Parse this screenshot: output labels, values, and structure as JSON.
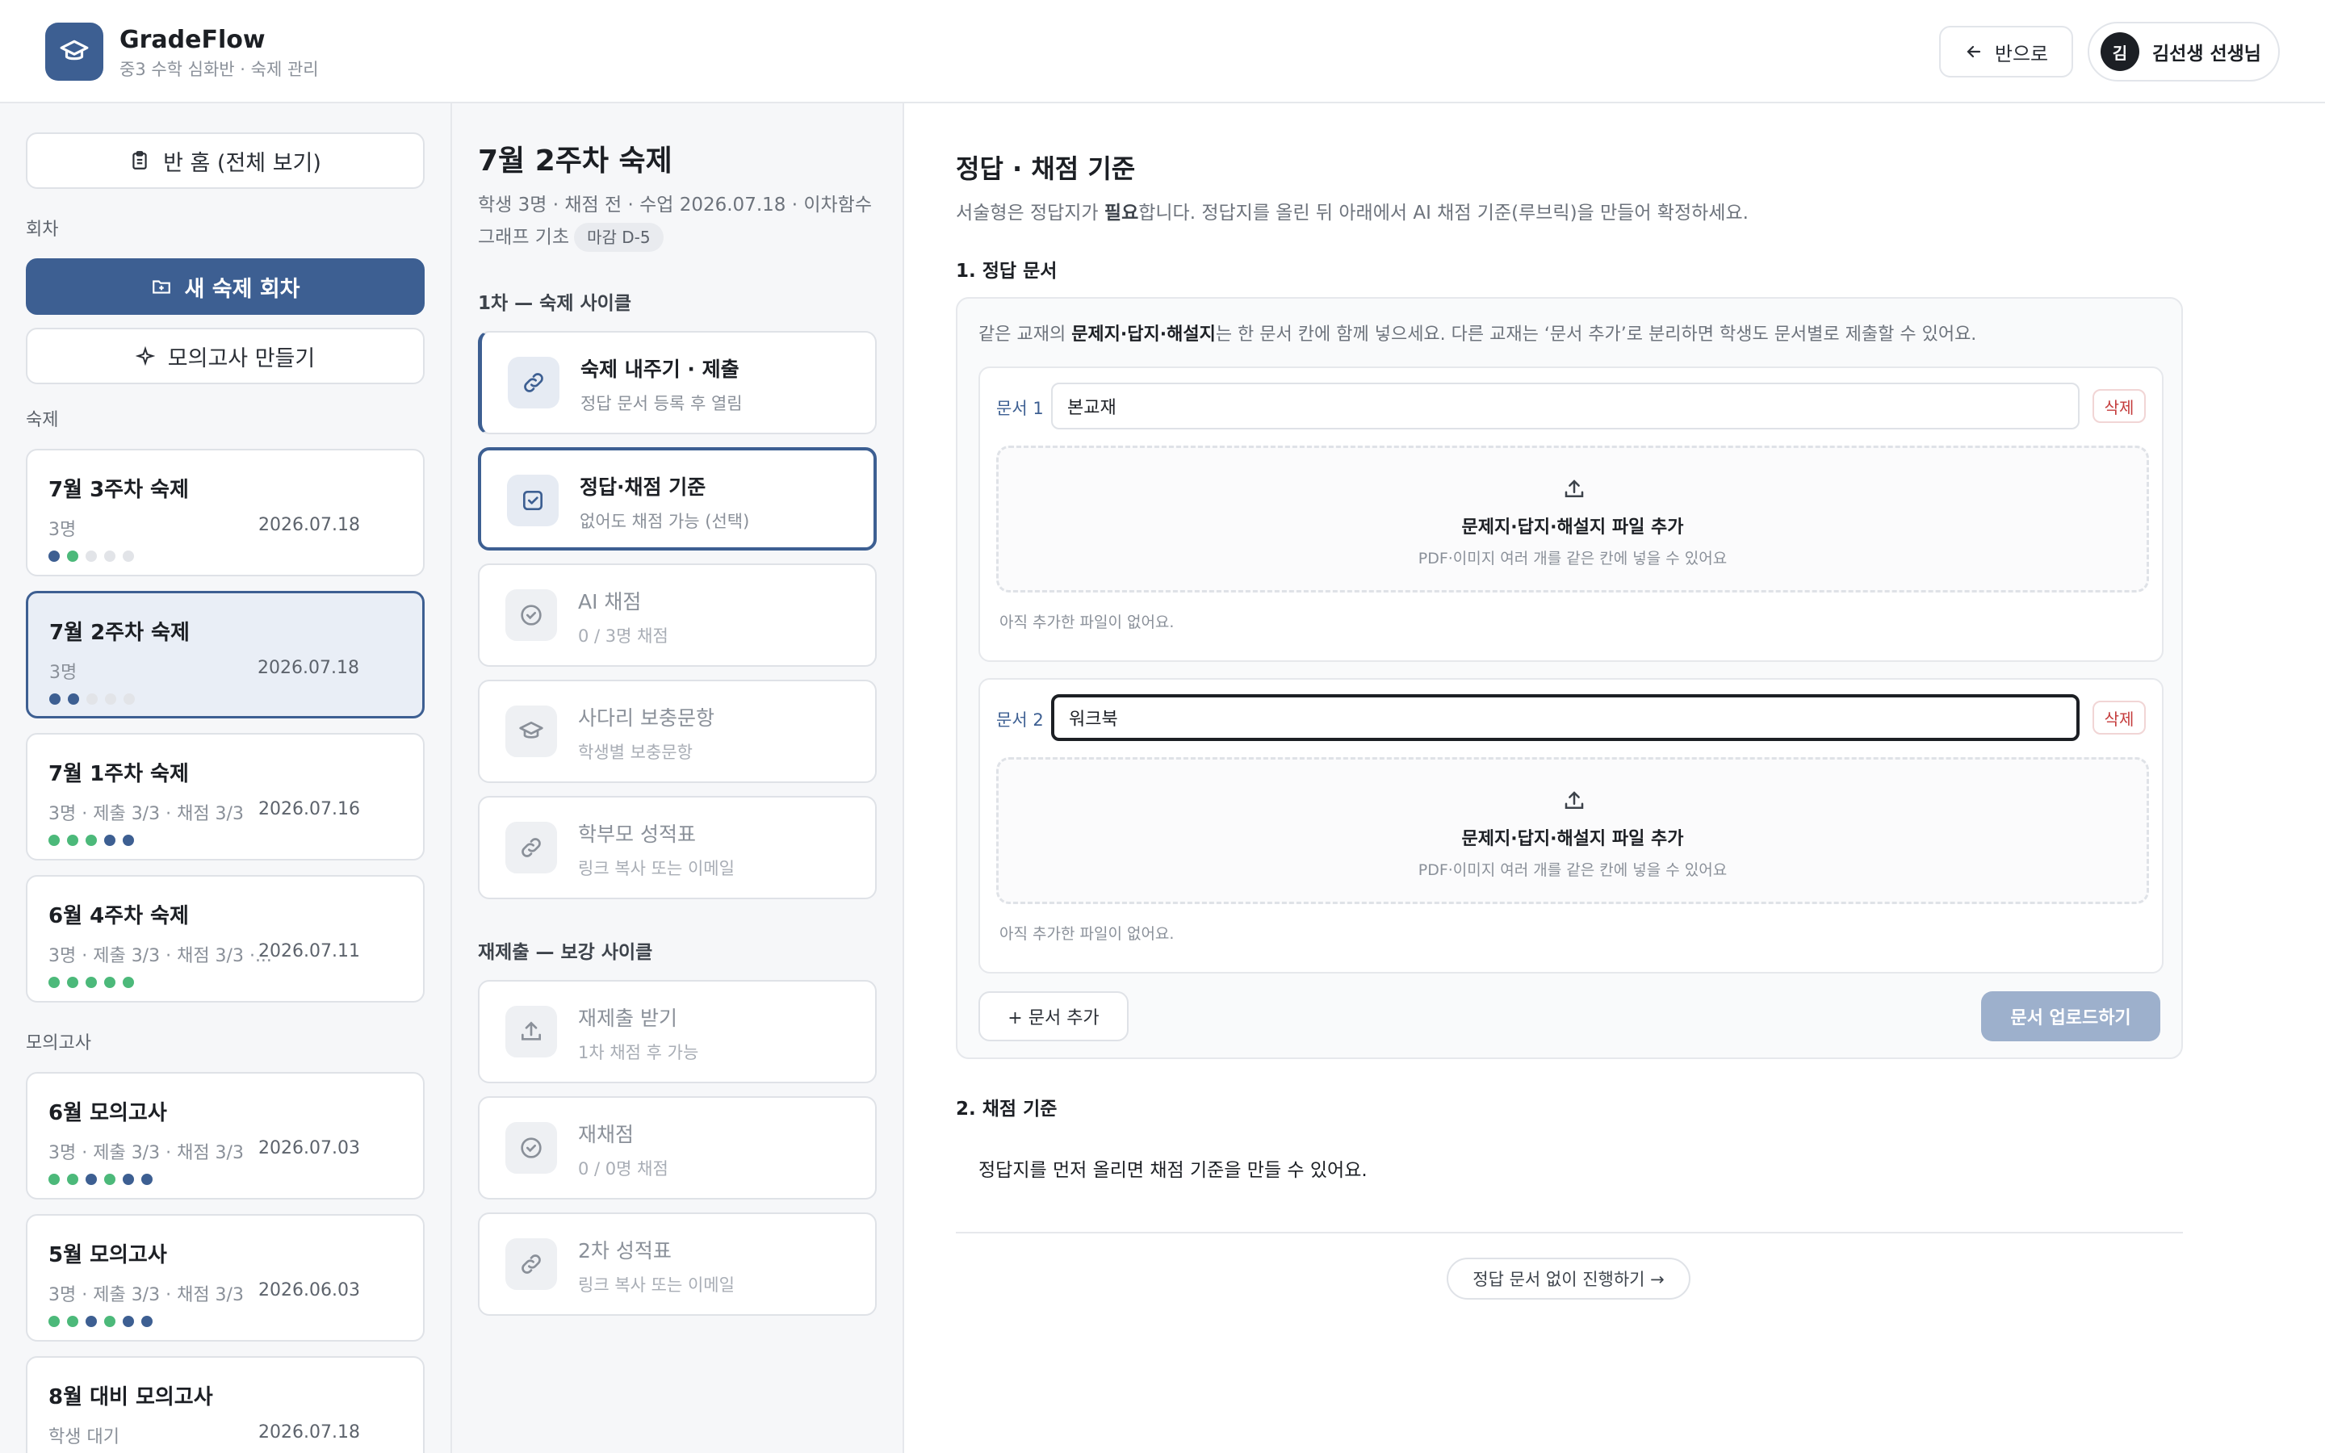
{
  "header": {
    "app_name": "GradeFlow",
    "app_sub": "중3 수학 심화반 · 숙제 관리",
    "back_label": "반으로",
    "user_initial": "김",
    "user_name": "김선생 선생님"
  },
  "sidebar": {
    "home_label": "반 홈 (전체 보기)",
    "rounds_label": "회차",
    "new_round_label": "새 숙제 회차",
    "mock_exam_create_label": "모의고사 만들기",
    "homework_label": "숙제",
    "homework": [
      {
        "title": "7월 3주차 숙제",
        "sub": "3명",
        "date": "2026.07.18",
        "dots": [
          "blue",
          "green",
          "gray",
          "gray",
          "gray"
        ]
      },
      {
        "title": "7월 2주차 숙제",
        "sub": "3명",
        "date": "2026.07.18",
        "dots": [
          "blue",
          "blue",
          "gray",
          "gray",
          "gray"
        ]
      },
      {
        "title": "7월 1주차 숙제",
        "sub": "3명 · 제출 3/3 · 채점 3/3",
        "date": "2026.07.16",
        "dots": [
          "green",
          "green",
          "green",
          "blue",
          "blue"
        ]
      },
      {
        "title": "6월 4주차 숙제",
        "sub": "3명 · 제출 3/3 · 채점 3/3 ·...",
        "date": "2026.07.11",
        "dots": [
          "green",
          "green",
          "green",
          "green",
          "green"
        ]
      }
    ],
    "mock_label": "모의고사",
    "mock_exams": [
      {
        "title": "6월 모의고사",
        "sub": "3명 · 제출 3/3 · 채점 3/3",
        "date": "2026.07.03",
        "dots": [
          "green",
          "green",
          "blue",
          "green",
          "blue",
          "blue"
        ]
      },
      {
        "title": "5월 모의고사",
        "sub": "3명 · 제출 3/3 · 채점 3/3",
        "date": "2026.06.03",
        "dots": [
          "green",
          "green",
          "blue",
          "green",
          "blue",
          "blue"
        ]
      },
      {
        "title": "8월 대비 모의고사",
        "sub": "학생 대기",
        "date": "2026.07.18",
        "dots": []
      }
    ]
  },
  "mid": {
    "title": "7월 2주차 숙제",
    "meta_line1": "학생 3명 · 채점 전 · 수업 2026.07.18 · 이차함수",
    "meta_line2": "그래프 기초",
    "deadline": "마감 D-5",
    "cycle1_label": "1차 — 숙제 사이클",
    "cycle1_steps": [
      {
        "title": "숙제 내주기 · 제출",
        "sub": "정답 문서 등록 후 열림"
      },
      {
        "title": "정답·채점 기준",
        "sub": "없어도 채점 가능 (선택)"
      },
      {
        "title": "AI 채점",
        "sub": "0 / 3명 채점"
      },
      {
        "title": "사다리 보충문항",
        "sub": "학생별 보충문항"
      },
      {
        "title": "학부모 성적표",
        "sub": "링크 복사 또는 이메일"
      }
    ],
    "cycle2_label": "재제출 — 보강 사이클",
    "cycle2_steps": [
      {
        "title": "재제출 받기",
        "sub": "1차 채점 후 가능"
      },
      {
        "title": "재채점",
        "sub": "0 / 0명 채점"
      },
      {
        "title": "2차 성적표",
        "sub": "링크 복사 또는 이메일"
      }
    ]
  },
  "main": {
    "title": "정답 · 채점 기준",
    "desc_pre": "서술형은 정답지가 ",
    "desc_bold": "필요",
    "desc_post": "합니다. 정답지를 올린 뒤 아래에서 AI 채점 기준(루브릭)을 만들어 확정하세요.",
    "section1": "1. 정답 문서",
    "hint_pre": "같은 교재의 ",
    "hint_bold": "문제지·답지·해설지",
    "hint_post": "는 한 문서 칸에 함께 넣으세요. 다른 교재는 ‘문서 추가’로 분리하면 학생도 문서별로 제출할 수 있어요.",
    "docs": [
      {
        "label": "문서 1",
        "value": "본교재",
        "delete": "삭제",
        "drop_title": "문제지·답지·해설지 파일 추가",
        "drop_sub": "PDF·이미지 여러 개를 같은 칸에 넣을 수 있어요",
        "empty": "아직 추가한 파일이 없어요."
      },
      {
        "label": "문서 2",
        "value": "워크북",
        "delete": "삭제",
        "drop_title": "문제지·답지·해설지 파일 추가",
        "drop_sub": "PDF·이미지 여러 개를 같은 칸에 넣을 수 있어요",
        "empty": "아직 추가한 파일이 없어요."
      }
    ],
    "add_doc": "+ 문서 추가",
    "upload": "문서 업로드하기",
    "section2": "2. 채점 기준",
    "grade_note": "정답지를 먼저 올리면 채점 기준을 만들 수 있어요.",
    "skip": "정답 문서 없이 진행하기 →"
  },
  "colors": {
    "accent": "#3d5f92",
    "success": "#4cb97a",
    "danger": "#c43b3b"
  }
}
